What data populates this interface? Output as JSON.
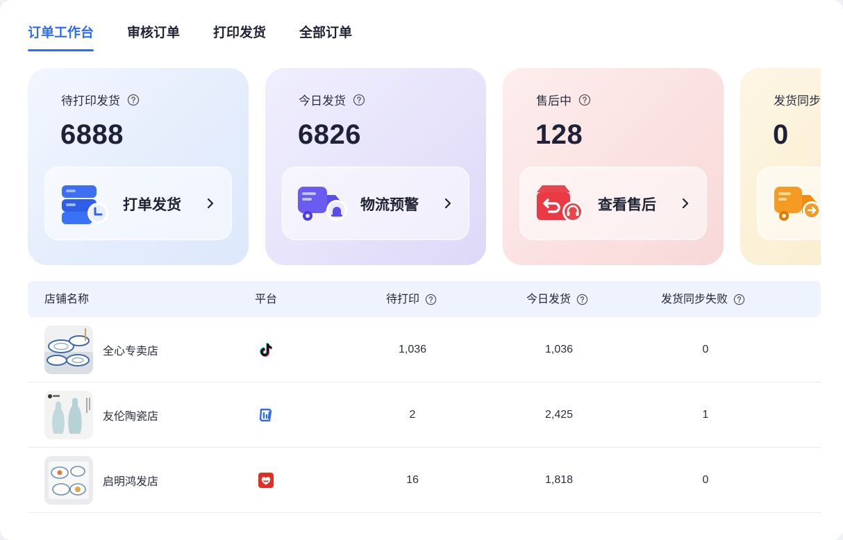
{
  "tabs": [
    {
      "label": "订单工作台",
      "active": true
    },
    {
      "label": "审核订单",
      "active": false
    },
    {
      "label": "打印发货",
      "active": false
    },
    {
      "label": "全部订单",
      "active": false
    }
  ],
  "cards": [
    {
      "label": "待打印发货",
      "value": "6888",
      "action": "打单发货",
      "icon": "print-ship-illustration"
    },
    {
      "label": "今日发货",
      "value": "6826",
      "action": "物流预警",
      "icon": "truck-alert-illustration"
    },
    {
      "label": "售后中",
      "value": "128",
      "action": "查看售后",
      "icon": "after-sale-box-illustration"
    },
    {
      "label": "发货同步",
      "value": "0",
      "action": "",
      "icon": "truck-sync-illustration"
    }
  ],
  "table": {
    "headers": [
      "店铺名称",
      "平台",
      "待打印",
      "今日发货",
      "发货同步失败"
    ],
    "rows": [
      {
        "store": "全心专卖店",
        "platform": "douyin-icon",
        "pending": "1,036",
        "today": "1,036",
        "failed": "0"
      },
      {
        "store": "友伦陶瓷店",
        "platform": "kuaishou-icon",
        "pending": "2",
        "today": "2,425",
        "failed": "1"
      },
      {
        "store": "启明鸿发店",
        "platform": "pinduoduo-icon",
        "pending": "16",
        "today": "1,818",
        "failed": "0"
      }
    ]
  },
  "colors": {
    "accent": "#2f6bf6",
    "header_bg": "#eef3fd"
  }
}
